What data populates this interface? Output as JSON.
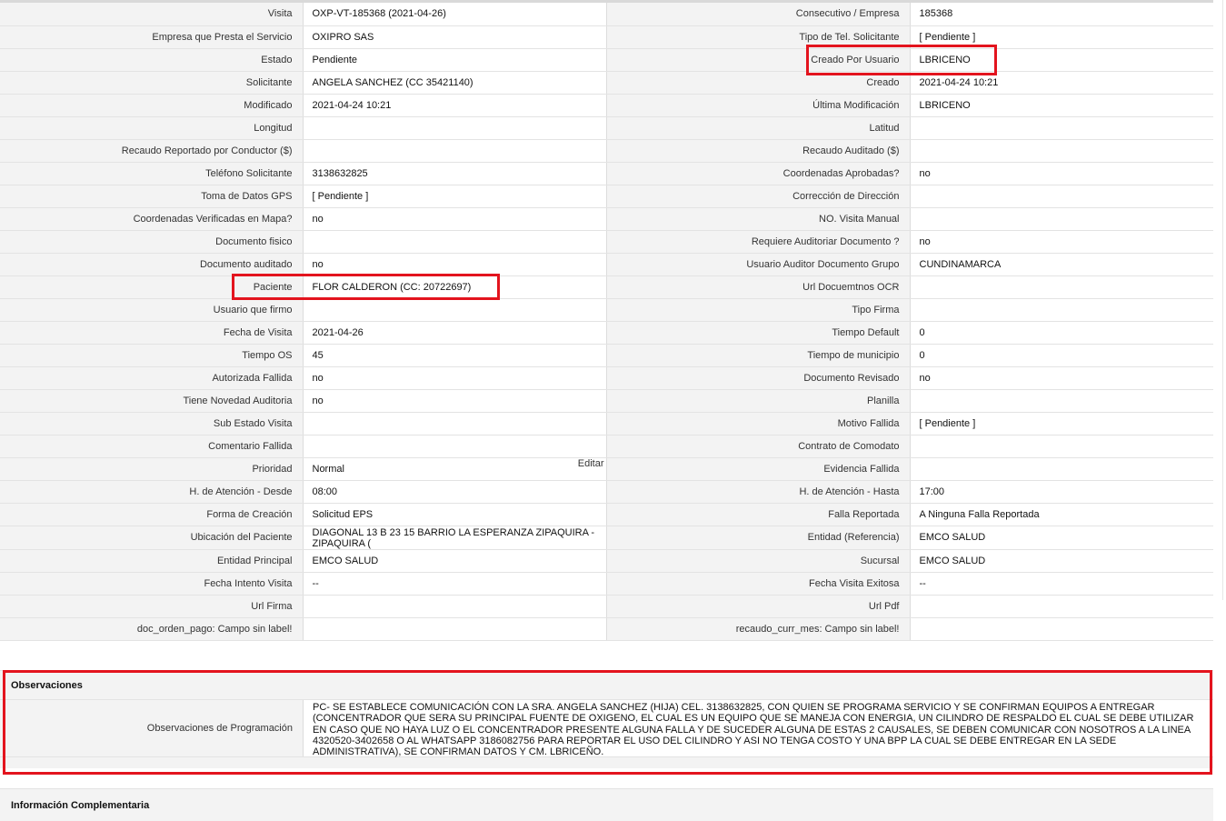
{
  "rows": [
    {
      "l1": "Visita",
      "v1": "OXP-VT-185368 (2021-04-26)",
      "l2": "Consecutivo / Empresa",
      "v2": "185368"
    },
    {
      "l1": "Empresa que Presta el Servicio",
      "v1": "OXIPRO SAS",
      "l2": "Tipo de Tel. Solicitante",
      "v2": "[ Pendiente ]"
    },
    {
      "l1": "Estado",
      "v1": "Pendiente",
      "l2": "Creado Por Usuario",
      "v2": "LBRICENO"
    },
    {
      "l1": "Solicitante",
      "v1": "ANGELA SANCHEZ (CC 35421140)",
      "l2": "Creado",
      "v2": "2021-04-24 10:21"
    },
    {
      "l1": "Modificado",
      "v1": "2021-04-24 10:21",
      "l2": "Última Modificación",
      "v2": " LBRICENO"
    },
    {
      "l1": "Longitud",
      "v1": "",
      "l2": "Latitud",
      "v2": ""
    },
    {
      "l1": "Recaudo Reportado por Conductor ($)",
      "v1": "",
      "l2": "Recaudo Auditado ($)",
      "v2": ""
    },
    {
      "l1": "Teléfono Solicitante",
      "v1": "3138632825",
      "l2": "Coordenadas Aprobadas?",
      "v2": " no"
    },
    {
      "l1": "Toma de Datos GPS",
      "v1": "[ Pendiente ]",
      "l2": "Corrección de Dirección",
      "v2": ""
    },
    {
      "l1": "Coordenadas Verificadas en Mapa?",
      "v1": " no",
      "l2": "NO. Visita Manual",
      "v2": ""
    },
    {
      "l1": "Documento fisico",
      "v1": "",
      "l2": "Requiere Auditoriar Documento ?",
      "v2": " no"
    },
    {
      "l1": "Documento auditado",
      "v1": " no",
      "l2": "Usuario Auditor Documento Grupo",
      "v2": "CUNDINAMARCA"
    },
    {
      "l1": "Paciente",
      "v1": "FLOR CALDERON (CC: 20722697)",
      "l2": "Url Docuemtnos OCR",
      "v2": ""
    },
    {
      "l1": "Usuario que firmo",
      "v1": "",
      "l2": "Tipo Firma",
      "v2": ""
    },
    {
      "l1": "Fecha de Visita",
      "v1": " 2021-04-26",
      "l2": "Tiempo Default",
      "v2": "0"
    },
    {
      "l1": "Tiempo OS",
      "v1": "45",
      "l2": "Tiempo de municipio",
      "v2": "0"
    },
    {
      "l1": "Autorizada Fallida",
      "v1": " no",
      "l2": "Documento Revisado",
      "v2": " no"
    },
    {
      "l1": "Tiene Novedad Auditoria",
      "v1": " no",
      "l2": "Planilla",
      "v2": ""
    },
    {
      "l1": "Sub Estado Visita",
      "v1": "",
      "l2": "Motivo Fallida",
      "v2": "[ Pendiente ]"
    },
    {
      "l1": "Comentario Fallida",
      "v1": "",
      "l2": "Contrato de Comodato",
      "v2": ""
    },
    {
      "l1": "Prioridad",
      "v1": "Normal",
      "l2": "Evidencia Fallida",
      "v2": ""
    },
    {
      "l1": "H. de Atención - Desde",
      "v1": "08:00",
      "l2": "H. de Atención - Hasta",
      "v2": "17:00"
    },
    {
      "l1": "Forma de Creación",
      "v1": "Solicitud EPS",
      "l2": "Falla Reportada",
      "v2": "A Ninguna Falla Reportada"
    },
    {
      "l1": "Ubicación del Paciente",
      "v1": "DIAGONAL 13 B 23 15 BARRIO LA ESPERANZA ZIPAQUIRA - ZIPAQUIRA (",
      "l2": "Entidad (Referencia)",
      "v2": "EMCO SALUD"
    },
    {
      "l1": "Entidad Principal",
      "v1": "EMCO SALUD",
      "l2": "Sucursal",
      "v2": "EMCO SALUD"
    },
    {
      "l1": "Fecha Intento Visita",
      "v1": " --",
      "l2": "Fecha Visita Exitosa",
      "v2": " --"
    },
    {
      "l1": "Url Firma",
      "v1": "",
      "l2": "Url Pdf",
      "v2": ""
    },
    {
      "l1": "doc_orden_pago: Campo sin label!",
      "v1": "",
      "l2": "recaudo_curr_mes: Campo sin label!",
      "v2": ""
    }
  ],
  "edit_label": "Editar",
  "observaciones": {
    "section_title": "Observaciones",
    "label": "Observaciones de Programación",
    "text": "  PC- SE ESTABLECE COMUNICACIÓN CON LA SRA. ANGELA SANCHEZ (HIJA) CEL. 3138632825, CON QUIEN SE PROGRAMA SERVICIO Y SE CONFIRMAN EQUIPOS A ENTREGAR (CONCENTRADOR QUE SERA SU PRINCIPAL FUENTE DE OXIGENO, EL CUAL ES UN EQUIPO QUE SE MANEJA CON ENERGIA, UN CILINDRO DE RESPALDO EL CUAL SE DEBE UTILIZAR EN CASO QUE NO HAYA LUZ O EL CONCENTRADOR PRESENTE ALGUNA FALLA Y DE SUCEDER ALGUNA DE ESTAS 2 CAUSALES, SE DEBEN COMUNICAR CON NOSOTROS A LA LINEA 4320520-3402658 O AL WHATSAPP 3186082756 PARA REPORTAR EL USO DEL CILINDRO Y ASI NO TENGA COSTO Y UNA BPP LA CUAL SE DEBE ENTREGAR EN LA SEDE ADMINISTRATIVA), SE CONFIRMAN DATOS Y CM. LBRICEÑO."
  },
  "info_complementaria": {
    "section_title": "Información Complementaria"
  },
  "colors": {
    "highlight": "#e3141e",
    "label_bg": "#f3f3f3"
  }
}
